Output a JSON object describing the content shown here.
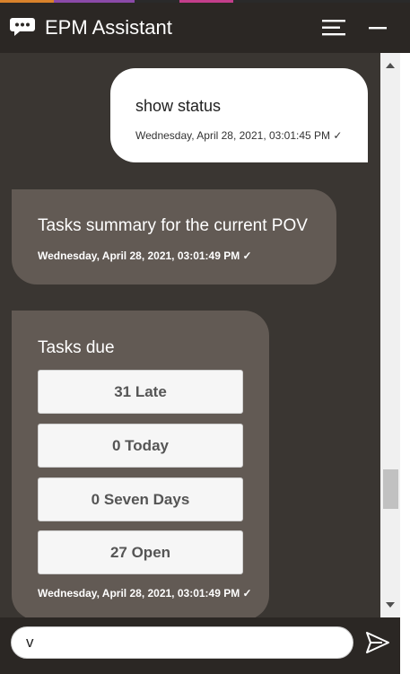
{
  "header": {
    "title": "EPM Assistant",
    "logo_icon": "chat-bubble-icon",
    "menu_icon": "hamburger-menu-icon",
    "minimize_icon": "minimize-icon"
  },
  "messages": {
    "user": {
      "text": "show status",
      "time": "Wednesday, April 28, 2021, 03:01:45 PM ✓"
    },
    "bot_summary": {
      "text": "Tasks summary for the current POV",
      "time": "Wednesday, April 28, 2021, 03:01:49 PM ✓"
    },
    "bot_tasks": {
      "title": "Tasks due",
      "buttons": [
        "31 Late",
        "0 Today",
        "0 Seven Days",
        "27 Open"
      ],
      "time": "Wednesday, April 28, 2021, 03:01:49 PM ✓"
    }
  },
  "input": {
    "value": "v",
    "send_icon": "send-icon"
  },
  "colors": {
    "header_bg": "#2b2724",
    "chat_bg": "#3a3632",
    "bot_bubble": "#625a54",
    "user_bubble": "#ffffff"
  }
}
